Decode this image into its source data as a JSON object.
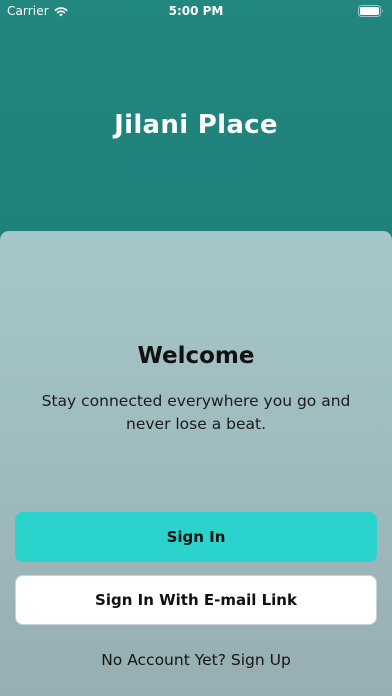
{
  "status_bar": {
    "carrier": "Carrier",
    "time": "5:00 PM",
    "icons": [
      "wifi-icon",
      "battery-icon"
    ]
  },
  "header": {
    "title": "Jilani Place"
  },
  "welcome": {
    "title": "Welcome",
    "text": "Stay connected everywhere you go and never lose a beat."
  },
  "actions": {
    "sign_in_label": "Sign In",
    "email_link_label": "Sign In With E-mail Link",
    "signup_label": "No Account Yet? Sign Up"
  },
  "colors": {
    "header_teal": "#1f7e78",
    "primary_button": "#2ad4cd",
    "card_top": "#a5c7c8",
    "card_bottom": "#97aeb2"
  }
}
